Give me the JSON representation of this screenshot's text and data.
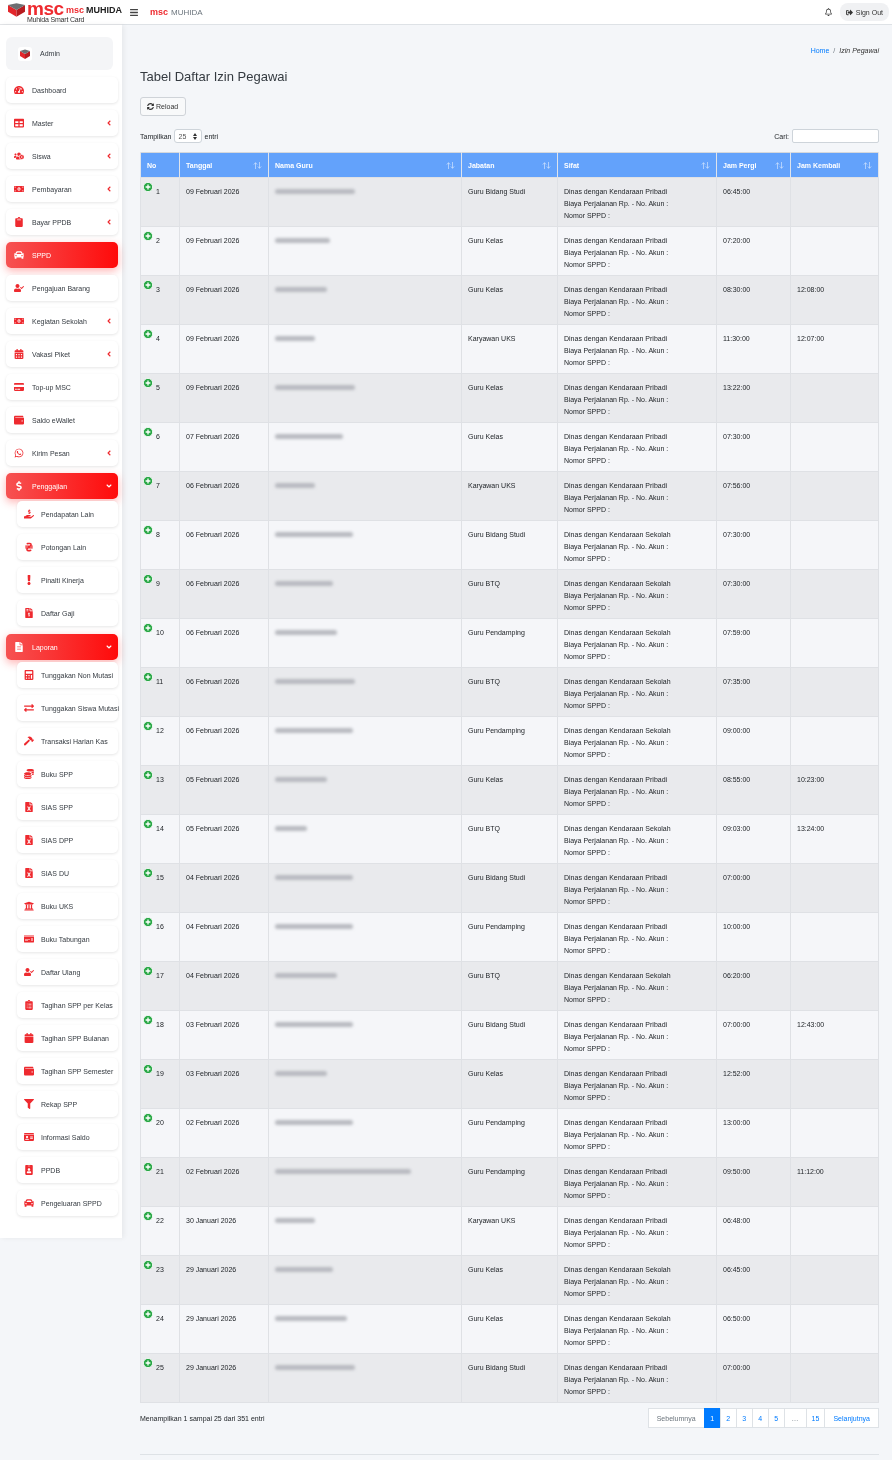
{
  "brand": {
    "logo_text": "msc",
    "tagline": "Muhida Smart Card",
    "name_prefix": "msc",
    "name": "MUHIDA"
  },
  "navbar": {
    "title_prefix": "msc",
    "title": "MUHIDA",
    "sign_out": "Sign Out"
  },
  "sidebar": {
    "user": "Admin",
    "items": [
      {
        "label": "Dashboard",
        "kind": "link",
        "selected": false
      },
      {
        "label": "Master",
        "kind": "menu",
        "selected": false,
        "expanded": false
      },
      {
        "label": "Siswa",
        "kind": "menu",
        "selected": false,
        "expanded": false
      },
      {
        "label": "Pembayaran",
        "kind": "menu",
        "selected": false,
        "expanded": false
      },
      {
        "label": "Bayar PPDB",
        "kind": "menu",
        "selected": false,
        "expanded": false
      },
      {
        "label": "SPPD",
        "kind": "link",
        "selected": true
      },
      {
        "label": "Pengajuan Barang",
        "kind": "link",
        "selected": false
      },
      {
        "label": "Kegiatan Sekolah",
        "kind": "menu",
        "selected": false,
        "expanded": false
      },
      {
        "label": "Vakasi Piket",
        "kind": "menu",
        "selected": false,
        "expanded": false
      },
      {
        "label": "Top-up MSC",
        "kind": "link",
        "selected": false
      },
      {
        "label": "Saldo eWallet",
        "kind": "link",
        "selected": false
      },
      {
        "label": "Kirim Pesan",
        "kind": "menu",
        "selected": false,
        "expanded": false
      },
      {
        "label": "Penggajian",
        "kind": "menu",
        "selected": true,
        "expanded": true,
        "children": [
          {
            "label": "Pendapatan Lain",
            "selected": false
          },
          {
            "label": "Potongan Lain",
            "selected": false
          },
          {
            "label": "Pinalti Kinerja",
            "selected": false
          },
          {
            "label": "Daftar Gaji",
            "selected": false
          }
        ]
      },
      {
        "label": "Laporan",
        "kind": "menu",
        "selected": true,
        "expanded": true,
        "children": [
          {
            "label": "Tunggakan Non Mutasi",
            "selected": false
          },
          {
            "label": "Tunggakan Siswa Mutasi",
            "selected": false
          },
          {
            "label": "Transaksi Harian Kas",
            "selected": false
          },
          {
            "label": "Buku SPP",
            "selected": false
          },
          {
            "label": "SIAS SPP",
            "selected": false
          },
          {
            "label": "SIAS DPP",
            "selected": false
          },
          {
            "label": "SIAS DU",
            "selected": false
          },
          {
            "label": "Buku UKS",
            "selected": false
          },
          {
            "label": "Buku Tabungan",
            "selected": false
          },
          {
            "label": "Daftar Ulang",
            "selected": false
          },
          {
            "label": "Tagihan SPP per Kelas",
            "selected": false
          },
          {
            "label": "Tagihan SPP Bulanan",
            "selected": false
          },
          {
            "label": "Tagihan SPP Semester",
            "selected": false
          },
          {
            "label": "Rekap SPP",
            "selected": false
          },
          {
            "label": "Informasi Saldo",
            "selected": false
          },
          {
            "label": "PPDB",
            "selected": false
          },
          {
            "label": "Pengeluaran SPPD",
            "selected": false
          }
        ]
      }
    ]
  },
  "breadcrumb": {
    "items": [
      {
        "label": "Home",
        "kind": "link"
      },
      {
        "label": "Izin Pegawai",
        "kind": "current"
      }
    ],
    "separator": "/"
  },
  "page_title": "Tabel Daftar Izin Pegawai",
  "reload_button": "Reload",
  "length_control": {
    "label_before": "Tampilkan",
    "value": "25",
    "label_after": "entri"
  },
  "search": {
    "label": "Cari:"
  },
  "table": {
    "columns": [
      {
        "label": "No",
        "sortable": false
      },
      {
        "label": "Tanggal",
        "sortable": true
      },
      {
        "label": "Nama Guru",
        "sortable": true
      },
      {
        "label": "Jabatan",
        "sortable": true
      },
      {
        "label": "Sifat",
        "sortable": true
      },
      {
        "label": "Jam Pergi",
        "sortable": true
      },
      {
        "label": "Jam Kembali",
        "sortable": true
      }
    ],
    "rows": [
      {
        "no": "1",
        "tanggal": "09 Februari 2026",
        "jabatan": "Guru Bidang Studi",
        "sifat": [
          "Dinas dengan Kendaraan Pribadi",
          "Biaya Perjalanan Rp. - No. Akun :",
          "Nomor SPPD :"
        ],
        "jam_pergi": "06:45:00"
      },
      {
        "no": "2",
        "tanggal": "09 Februari 2026",
        "jabatan": "Guru Kelas",
        "sifat": [
          "Dinas dengan Kendaraan Pribadi",
          "Biaya Perjalanan Rp. - No. Akun :",
          "Nomor SPPD :"
        ],
        "jam_pergi": "07:20:00"
      },
      {
        "no": "3",
        "tanggal": "09 Februari 2026",
        "jabatan": "Guru Kelas",
        "sifat": [
          "Dinas dengan Kendaraan Pribadi",
          "Biaya Perjalanan Rp. - No. Akun :",
          "Nomor SPPD :"
        ],
        "jam_pergi": "08:30:00",
        "jam_kembali": "12:08:00"
      },
      {
        "no": "4",
        "tanggal": "09 Februari 2026",
        "jabatan": "Karyawan UKS",
        "sifat": [
          "Dinas dengan Kendaraan Pribadi",
          "Biaya Perjalanan Rp. - No. Akun :",
          "Nomor SPPD :"
        ],
        "jam_pergi": "11:30:00",
        "jam_kembali": "12:07:00"
      },
      {
        "no": "5",
        "tanggal": "09 Februari 2026",
        "jabatan": "Guru Kelas",
        "sifat": [
          "Dinas dengan Kendaraan Pribadi",
          "Biaya Perjalanan Rp. - No. Akun :",
          "Nomor SPPD :"
        ],
        "jam_pergi": "13:22:00"
      },
      {
        "no": "6",
        "tanggal": "07 Februari 2026",
        "jabatan": "Guru Kelas",
        "sifat": [
          "Dinas dengan Kendaraan Pribadi",
          "Biaya Perjalanan Rp. - No. Akun :",
          "Nomor SPPD :"
        ],
        "jam_pergi": "07:30:00"
      },
      {
        "no": "7",
        "tanggal": "06 Februari 2026",
        "jabatan": "Karyawan UKS",
        "sifat": [
          "Dinas dengan Kendaraan Pribadi",
          "Biaya Perjalanan Rp. - No. Akun :",
          "Nomor SPPD :"
        ],
        "jam_pergi": "07:56:00"
      },
      {
        "no": "8",
        "tanggal": "06 Februari 2026",
        "jabatan": "Guru Bidang Studi",
        "sifat": [
          "Dinas dengan Kendaraan Sekolah",
          "Biaya Perjalanan Rp. - No. Akun :",
          "Nomor SPPD :"
        ],
        "jam_pergi": "07:30:00"
      },
      {
        "no": "9",
        "tanggal": "06 Februari 2026",
        "jabatan": "Guru BTQ",
        "sifat": [
          "Dinas dengan Kendaraan Sekolah",
          "Biaya Perjalanan Rp. - No. Akun :",
          "Nomor SPPD :"
        ],
        "jam_pergi": "07:30:00"
      },
      {
        "no": "10",
        "tanggal": "06 Februari 2026",
        "jabatan": "Guru Pendamping",
        "sifat": [
          "Dinas dengan Kendaraan Sekolah",
          "Biaya Perjalanan Rp. - No. Akun :",
          "Nomor SPPD :"
        ],
        "jam_pergi": "07:59:00"
      },
      {
        "no": "11",
        "tanggal": "06 Februari 2026",
        "jabatan": "Guru BTQ",
        "sifat": [
          "Dinas dengan Kendaraan Sekolah",
          "Biaya Perjalanan Rp. - No. Akun :",
          "Nomor SPPD :"
        ],
        "jam_pergi": "07:35:00"
      },
      {
        "no": "12",
        "tanggal": "06 Februari 2026",
        "jabatan": "Guru Pendamping",
        "sifat": [
          "Dinas dengan Kendaraan Sekolah",
          "Biaya Perjalanan Rp. - No. Akun :",
          "Nomor SPPD :"
        ],
        "jam_pergi": "09:00:00"
      },
      {
        "no": "13",
        "tanggal": "05 Februari 2026",
        "jabatan": "Guru Kelas",
        "sifat": [
          "Dinas dengan Kendaraan Pribadi",
          "Biaya Perjalanan Rp. - No. Akun :",
          "Nomor SPPD :"
        ],
        "jam_pergi": "08:55:00",
        "jam_kembali": "10:23:00"
      },
      {
        "no": "14",
        "tanggal": "05 Februari 2026",
        "jabatan": "Guru BTQ",
        "sifat": [
          "Dinas dengan Kendaraan Sekolah",
          "Biaya Perjalanan Rp. - No. Akun :",
          "Nomor SPPD :"
        ],
        "jam_pergi": "09:03:00",
        "jam_kembali": "13:24:00"
      },
      {
        "no": "15",
        "tanggal": "04 Februari 2026",
        "jabatan": "Guru Bidang Studi",
        "sifat": [
          "Dinas dengan Kendaraan Pribadi",
          "Biaya Perjalanan Rp. - No. Akun :",
          "Nomor SPPD :"
        ],
        "jam_pergi": "07:00:00"
      },
      {
        "no": "16",
        "tanggal": "04 Februari 2026",
        "jabatan": "Guru Pendamping",
        "sifat": [
          "Dinas dengan Kendaraan Pribadi",
          "Biaya Perjalanan Rp. - No. Akun :",
          "Nomor SPPD :"
        ],
        "jam_pergi": "10:00:00"
      },
      {
        "no": "17",
        "tanggal": "04 Februari 2026",
        "jabatan": "Guru BTQ",
        "sifat": [
          "Dinas dengan Kendaraan Sekolah",
          "Biaya Perjalanan Rp. - No. Akun :",
          "Nomor SPPD :"
        ],
        "jam_pergi": "06:20:00"
      },
      {
        "no": "18",
        "tanggal": "03 Februari 2026",
        "jabatan": "Guru Bidang Studi",
        "sifat": [
          "Dinas dengan Kendaraan Pribadi",
          "Biaya Perjalanan Rp. - No. Akun :",
          "Nomor SPPD :"
        ],
        "jam_pergi": "07:00:00",
        "jam_kembali": "12:43:00"
      },
      {
        "no": "19",
        "tanggal": "03 Februari 2026",
        "jabatan": "Guru Kelas",
        "sifat": [
          "Dinas dengan Kendaraan Pribadi",
          "Biaya Perjalanan Rp. - No. Akun :",
          "Nomor SPPD :"
        ],
        "jam_pergi": "12:52:00"
      },
      {
        "no": "20",
        "tanggal": "02 Februari 2026",
        "jabatan": "Guru Pendamping",
        "sifat": [
          "Dinas dengan Kendaraan Pribadi",
          "Biaya Perjalanan Rp. - No. Akun :",
          "Nomor SPPD :"
        ],
        "jam_pergi": "13:00:00"
      },
      {
        "no": "21",
        "tanggal": "02 Februari 2026",
        "jabatan": "Guru Pendamping",
        "sifat": [
          "Dinas dengan Kendaraan Pribadi",
          "Biaya Perjalanan Rp. - No. Akun :",
          "Nomor SPPD :"
        ],
        "jam_pergi": "09:50:00",
        "jam_kembali": "11:12:00"
      },
      {
        "no": "22",
        "tanggal": "30 Januari 2026",
        "jabatan": "Karyawan UKS",
        "sifat": [
          "Dinas dengan Kendaraan Pribadi",
          "Biaya Perjalanan Rp. - No. Akun :",
          "Nomor SPPD :"
        ],
        "jam_pergi": "06:48:00"
      },
      {
        "no": "23",
        "tanggal": "29 Januari 2026",
        "jabatan": "Guru Kelas",
        "sifat": [
          "Dinas dengan Kendaraan Sekolah",
          "Biaya Perjalanan Rp. - No. Akun :",
          "Nomor SPPD :"
        ],
        "jam_pergi": "06:45:00"
      },
      {
        "no": "24",
        "tanggal": "29 Januari 2026",
        "jabatan": "Guru Kelas",
        "sifat": [
          "Dinas dengan Kendaraan Sekolah",
          "Biaya Perjalanan Rp. - No. Akun :",
          "Nomor SPPD :"
        ],
        "jam_pergi": "06:50:00"
      },
      {
        "no": "25",
        "tanggal": "29 Januari 2026",
        "jabatan": "Guru Bidang Studi",
        "sifat": [
          "Dinas dengan Kendaraan Pribadi",
          "Biaya Perjalanan Rp. - No. Akun :",
          "Nomor SPPD :"
        ],
        "jam_pergi": "07:00:00"
      }
    ]
  },
  "info": "Menampilkan 1 sampai 25 dari 351 entri",
  "pagination": [
    {
      "label": "Sebelumnya",
      "kind": "prev",
      "disabled": true,
      "selected": false
    },
    {
      "label": "1",
      "kind": "page",
      "selected": true
    },
    {
      "label": "2",
      "kind": "page",
      "selected": false
    },
    {
      "label": "3",
      "kind": "page",
      "selected": false
    },
    {
      "label": "4",
      "kind": "page",
      "selected": false
    },
    {
      "label": "5",
      "kind": "page",
      "selected": false
    },
    {
      "label": "…",
      "kind": "ellipsis"
    },
    {
      "label": "15",
      "kind": "page",
      "selected": false
    },
    {
      "label": "Selanjutnya",
      "kind": "next",
      "disabled": false,
      "selected": false
    }
  ]
}
